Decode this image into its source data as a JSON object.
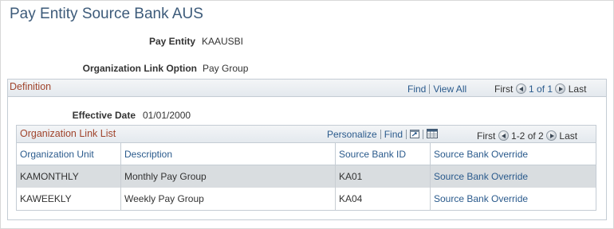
{
  "page": {
    "title": "Pay Entity Source Bank AUS"
  },
  "fields": {
    "pay_entity_label": "Pay Entity",
    "pay_entity_value": "KAAUSBI",
    "org_link_option_label": "Organization Link Option",
    "org_link_option_value": "Pay Group"
  },
  "definition": {
    "title": "Definition",
    "find_label": "Find",
    "view_all_label": "View All",
    "first_label": "First",
    "count_label": "1 of 1",
    "last_label": "Last",
    "effective_date_label": "Effective Date",
    "effective_date_value": "01/01/2000"
  },
  "grid": {
    "title": "Organization Link List",
    "personalize_label": "Personalize",
    "find_label": "Find",
    "first_label": "First",
    "count_label": "1-2 of 2",
    "last_label": "Last",
    "icons": [
      "view-icon",
      "spreadsheet-icon",
      "prev-icon",
      "next-icon"
    ],
    "columns": [
      "Organization Unit",
      "Description",
      "Source Bank ID",
      "Source Bank Override"
    ],
    "rows": [
      {
        "org_unit": "KAMONTHLY",
        "description": "Monthly Pay Group",
        "bank_id": "KA01",
        "override": "Source Bank Override"
      },
      {
        "org_unit": "KAWEEKLY",
        "description": "Weekly Pay Group",
        "bank_id": "KA04",
        "override": "Source Bank Override"
      }
    ]
  },
  "colors": {
    "title": "#3d5b7a",
    "group_title": "#a0442c",
    "link": "#2a5a8c",
    "row_alt": "#d9dde0"
  }
}
